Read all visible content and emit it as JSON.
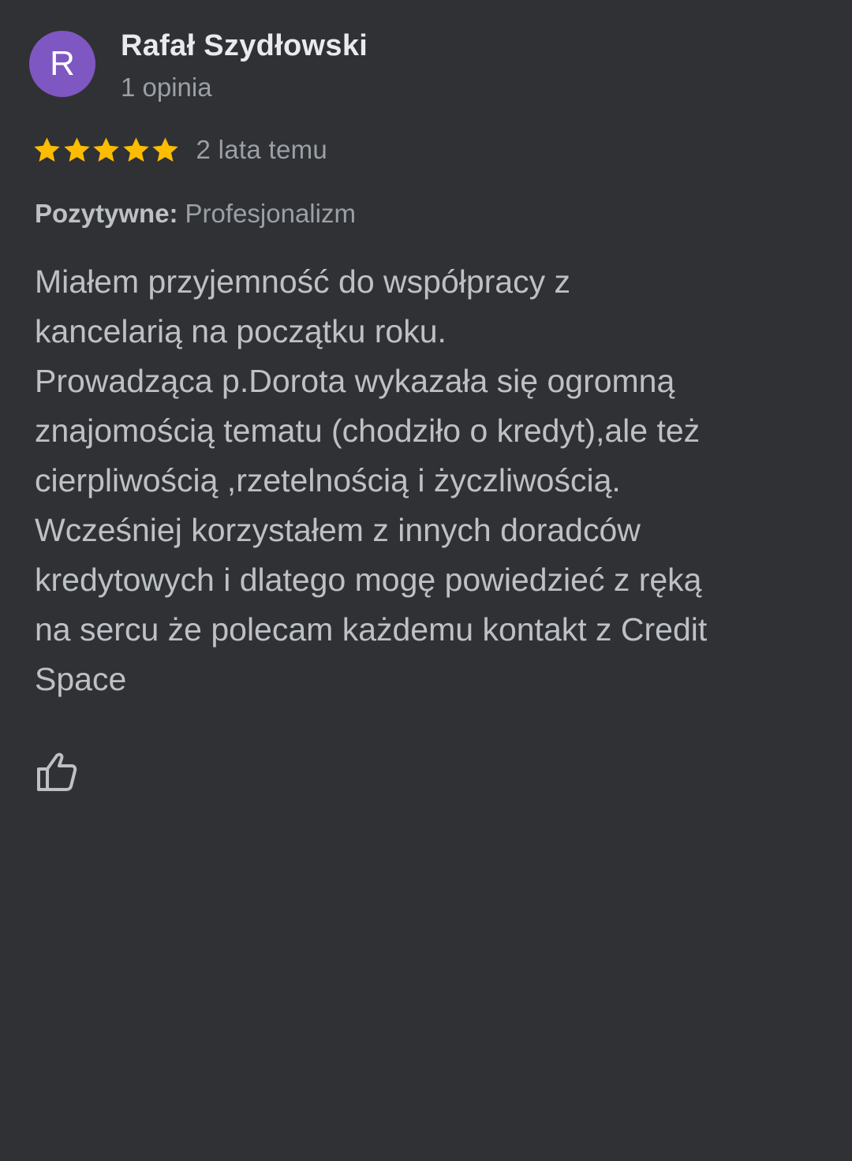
{
  "review": {
    "avatar_letter": "R",
    "author_name": "Rafał Szydłowski",
    "author_meta": "1 opinia",
    "rating": 5,
    "rating_max": 5,
    "date": "2 lata temu",
    "attribute_label": "Pozytywne:",
    "attribute_value": "Profesjonalizm",
    "text": "Miałem przyjemność do współpracy z\nkancelarią na początku roku.\nProwadząca p.Dorota wykazała się ogromną\nznajomością tematu (chodziło o kredyt),ale też\ncierpliwością ,rzetelnością i życzliwością.\nWcześniej korzystałem z innych doradców\nkredytowych i dlatego mogę powiedzieć z ręką\nna sercu że polecam każdemu kontakt z Credit\nSpace"
  },
  "actions": {
    "like_icon": "thumbs-up-icon"
  },
  "colors": {
    "background": "#303134",
    "avatar": "#7e57c2",
    "star": "#fbbc04",
    "primary_text": "#e8eaed",
    "secondary_text": "#9aa0a6",
    "body_text": "#bdc1c6"
  }
}
